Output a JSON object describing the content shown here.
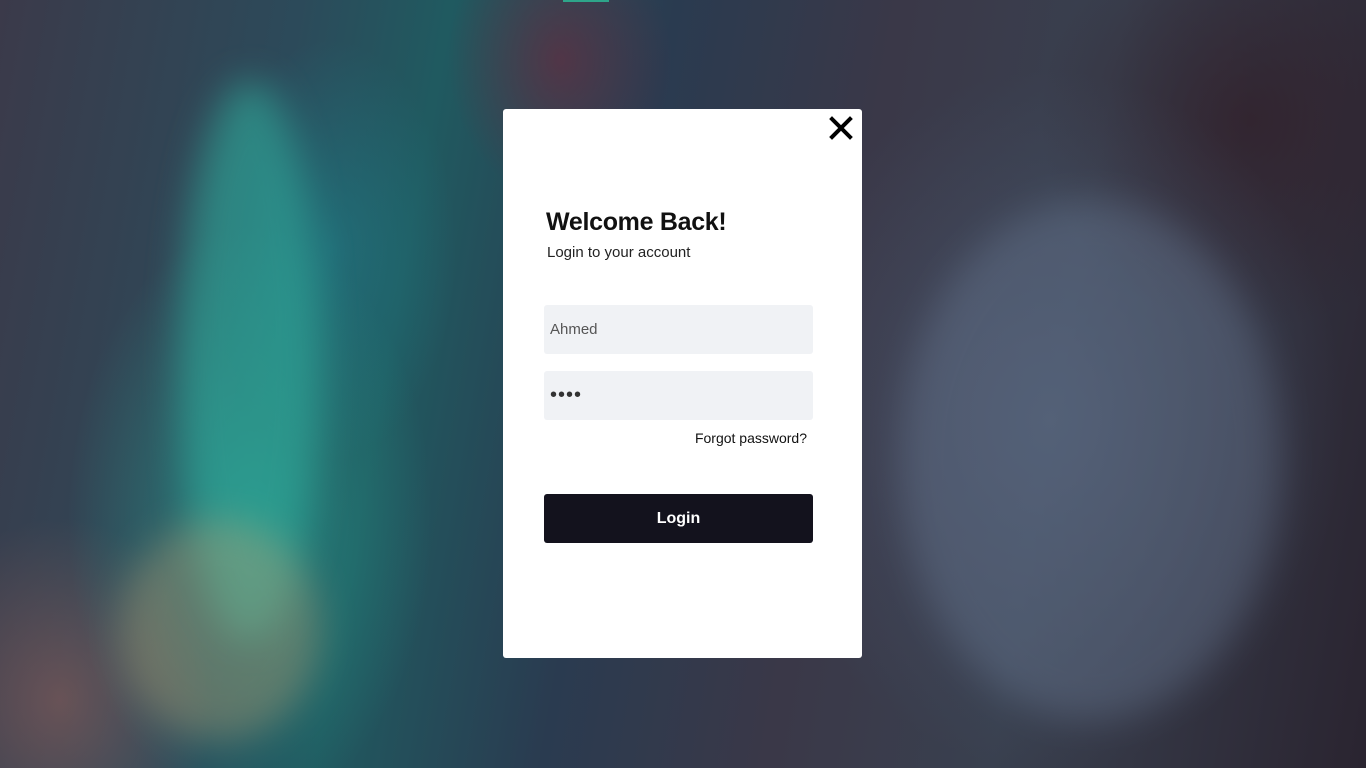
{
  "login_modal": {
    "title": "Welcome Back!",
    "subtitle": "Login to your account",
    "username_value": "Ahmed",
    "password_value": "1234",
    "forgot_password_label": "Forgot password?",
    "login_button_label": "Login",
    "close_icon": "close-icon"
  },
  "colors": {
    "button_background": "#13121d",
    "field_background": "#f0f2f5",
    "accent": "#2ea58a"
  }
}
